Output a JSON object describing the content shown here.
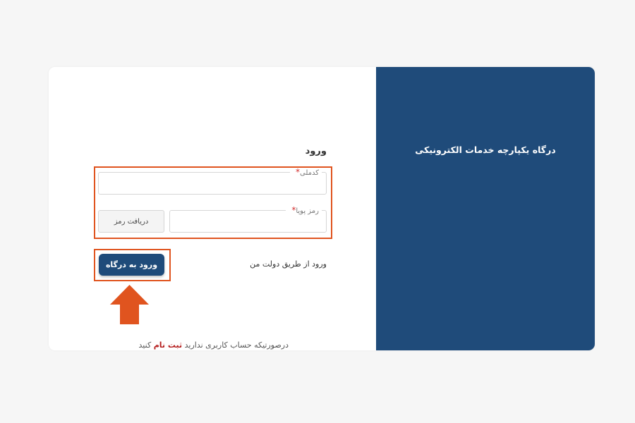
{
  "brand": {
    "title": "درگاه یکپارچه خدمات الکترونیکی"
  },
  "login": {
    "title": "ورود",
    "national_code": {
      "label": "کدملی",
      "required_mark": "*",
      "value": ""
    },
    "otp": {
      "label": "رمز پویا",
      "required_mark": "*",
      "value": ""
    },
    "get_otp_label": "دریافت رمز",
    "submit_label": "ورود به درگاه",
    "gov_login_label": "ورود از طریق دولت من"
  },
  "register": {
    "prefix": "درصورتیکه حساب کاربری ندارید",
    "link": "ثبت نام",
    "suffix": "کنید"
  },
  "colors": {
    "brand_blue": "#1f4b7a",
    "highlight_orange": "#e0541f",
    "register_red": "#b51f1f",
    "background": "#f6f6f6"
  },
  "annotations": {
    "arrow": "up-arrow-icon"
  }
}
